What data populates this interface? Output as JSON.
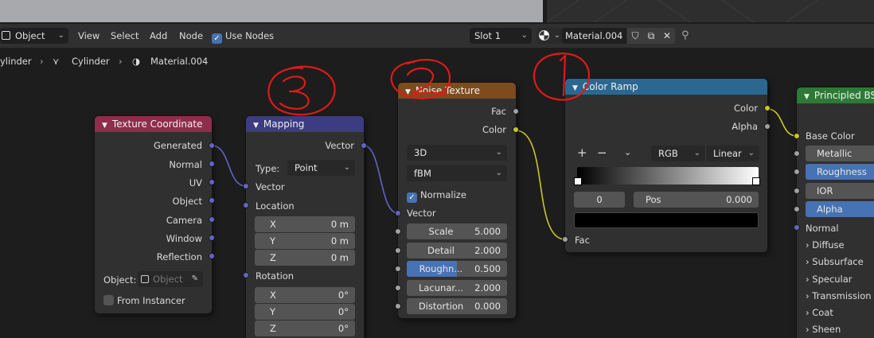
{
  "header": {
    "mode": "Object",
    "menus": [
      "View",
      "Select",
      "Add",
      "Node"
    ],
    "use_nodes_label": "Use Nodes",
    "slot": "Slot 1",
    "material_name": "Material.004"
  },
  "breadcrumb": [
    "ylinder",
    "Cylinder",
    "Material.004"
  ],
  "nodes": {
    "texture_coordinate": {
      "title": "Texture Coordinate",
      "outputs": [
        "Generated",
        "Normal",
        "UV",
        "Object",
        "Camera",
        "Window",
        "Reflection"
      ],
      "object_label": "Object:",
      "object_placeholder": "Object",
      "from_instancer": "From Instancer"
    },
    "mapping": {
      "title": "Mapping",
      "output": "Vector",
      "type_label": "Type:",
      "type_value": "Point",
      "vector_label": "Vector",
      "location_label": "Location",
      "location": [
        {
          "axis": "X",
          "value": "0 m"
        },
        {
          "axis": "Y",
          "value": "0 m"
        },
        {
          "axis": "Z",
          "value": "0 m"
        }
      ],
      "rotation_label": "Rotation",
      "rotation": [
        {
          "axis": "X",
          "value": "0°"
        },
        {
          "axis": "Y",
          "value": "0°"
        },
        {
          "axis": "Z",
          "value": "0°"
        }
      ]
    },
    "noise": {
      "title": "Noise Texture",
      "outputs": [
        "Fac",
        "Color"
      ],
      "dimensions": "3D",
      "type": "fBM",
      "normalize": "Normalize",
      "vector_label": "Vector",
      "fields": [
        {
          "label": "Scale",
          "value": "5.000"
        },
        {
          "label": "Detail",
          "value": "2.000"
        },
        {
          "label": "Roughn...",
          "value": "0.500",
          "fill": 0.5
        },
        {
          "label": "Lacunar...",
          "value": "2.000"
        },
        {
          "label": "Distortion",
          "value": "0.000"
        }
      ]
    },
    "color_ramp": {
      "title": "Color Ramp",
      "outputs": [
        "Color",
        "Alpha"
      ],
      "color_mode": "RGB",
      "interpolation": "Linear",
      "index": "0",
      "pos_label": "Pos",
      "pos_value": "0.000",
      "input": "Fac"
    },
    "principled": {
      "title": "Principled BS",
      "base_color": "Base Color",
      "fields": [
        "Metallic",
        "Roughness",
        "IOR",
        "Alpha"
      ],
      "normal": "Normal",
      "panels": [
        "Diffuse",
        "Subsurface",
        "Specular",
        "Transmission",
        "Coat",
        "Sheen"
      ]
    }
  },
  "colors": {
    "tex_coord_header": "#8e2d4c",
    "mapping_header": "#3c3c83",
    "noise_header": "#7e4b1c",
    "ramp_header": "#2a6891",
    "principled_header": "#2e7a35",
    "annotation": "#e01919"
  }
}
